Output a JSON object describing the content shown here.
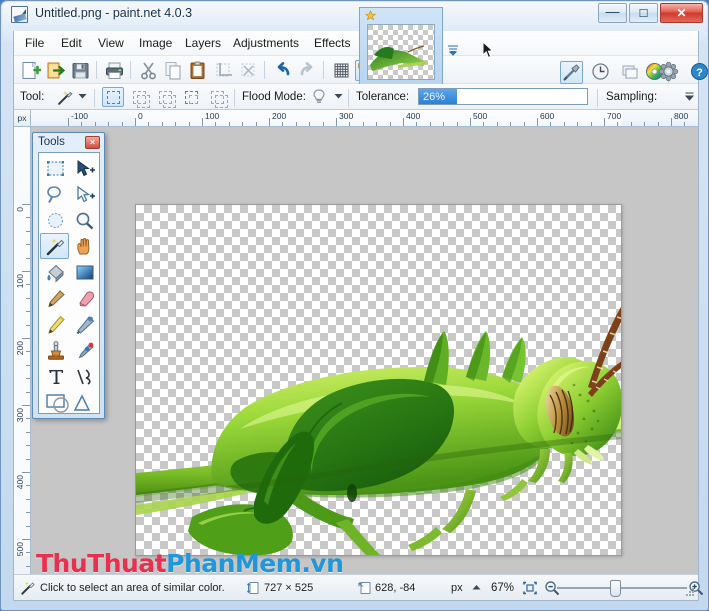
{
  "window": {
    "title": "Untitled.png - paint.net 4.0.3",
    "app_icon": "paintnet-app-icon",
    "controls": {
      "minimize": "—",
      "maximize": "❐",
      "close": "✕"
    }
  },
  "menubar": {
    "items": [
      {
        "label": "File"
      },
      {
        "label": "Edit"
      },
      {
        "label": "View"
      },
      {
        "label": "Image"
      },
      {
        "label": "Layers"
      },
      {
        "label": "Adjustments"
      },
      {
        "label": "Effects"
      }
    ]
  },
  "toolbar": {
    "buttons": [
      {
        "name": "new-icon",
        "tip": "New"
      },
      {
        "name": "open-icon",
        "tip": "Open"
      },
      {
        "name": "save-icon",
        "tip": "Save"
      },
      {
        "name": "print-icon",
        "tip": "Print"
      },
      {
        "name": "cut-icon",
        "tip": "Cut"
      },
      {
        "name": "copy-icon",
        "tip": "Copy"
      },
      {
        "name": "paste-icon",
        "tip": "Paste"
      },
      {
        "name": "crop-to-selection-icon",
        "tip": "Crop to Selection"
      },
      {
        "name": "deselect-all-icon",
        "tip": "Deselect All"
      },
      {
        "name": "undo-icon",
        "tip": "Undo"
      },
      {
        "name": "redo-icon",
        "tip": "Redo"
      },
      {
        "name": "grid-icon",
        "tip": "Show Pixel Grid"
      },
      {
        "name": "rulers-icon",
        "tip": "Show Rulers"
      }
    ]
  },
  "header_icons": [
    {
      "name": "tools-window-icon",
      "label": "Tools"
    },
    {
      "name": "history-window-icon",
      "label": "History"
    },
    {
      "name": "layers-window-icon",
      "label": "Layers"
    },
    {
      "name": "colors-window-icon",
      "label": "Colors"
    },
    {
      "name": "settings-icon",
      "label": "Settings"
    },
    {
      "name": "help-icon",
      "label": "Help"
    }
  ],
  "thumbnail": {
    "name": "image-thumbnail-untitled",
    "pinned_icon": "star-icon",
    "dropdown_icon": "chevron-down-icon"
  },
  "tool_options": {
    "tool_label": "Tool:",
    "tool_selected_icon": "magic-wand-icon",
    "tool_dropdown_icon": "chevron-down-icon",
    "selection_modes": [
      {
        "name": "selection-mode-replace",
        "label": "Replace",
        "active": true
      },
      {
        "name": "selection-mode-union",
        "label": "Union",
        "active": false
      },
      {
        "name": "selection-mode-exclude",
        "label": "Exclude",
        "active": false
      },
      {
        "name": "selection-mode-xor",
        "label": "Xor",
        "active": false
      },
      {
        "name": "selection-mode-intersect",
        "label": "Intersect",
        "active": false
      }
    ],
    "flood_mode_label": "Flood Mode:",
    "flood_mode_icon": "lightbulb-icon",
    "tolerance_label": "Tolerance:",
    "tolerance_value": "26%",
    "tolerance_percent": 26,
    "sampling_label": "Sampling:",
    "overflow_icon": "overflow-chevron-icon"
  },
  "tools_palette": {
    "title": "Tools",
    "close_label": "✕",
    "tools": [
      {
        "name": "rectangle-select-tool",
        "label": "Rectangle Select",
        "selected": false
      },
      {
        "name": "move-selected-tool",
        "label": "Move Selected",
        "selected": false
      },
      {
        "name": "lasso-select-tool",
        "label": "Lasso Select",
        "selected": false
      },
      {
        "name": "move-selection-tool",
        "label": "Move Selection",
        "selected": false
      },
      {
        "name": "ellipse-select-tool",
        "label": "Ellipse Select",
        "selected": false
      },
      {
        "name": "zoom-tool",
        "label": "Zoom",
        "selected": false
      },
      {
        "name": "magic-wand-tool",
        "label": "Magic Wand",
        "selected": true
      },
      {
        "name": "pan-tool",
        "label": "Pan",
        "selected": false
      },
      {
        "name": "paint-bucket-tool",
        "label": "Paint Bucket",
        "selected": false
      },
      {
        "name": "gradient-tool",
        "label": "Gradient",
        "selected": false
      },
      {
        "name": "paintbrush-tool",
        "label": "Paintbrush",
        "selected": false
      },
      {
        "name": "eraser-tool",
        "label": "Eraser",
        "selected": false
      },
      {
        "name": "pencil-tool",
        "label": "Pencil",
        "selected": false
      },
      {
        "name": "color-picker-tool",
        "label": "Color Picker",
        "selected": false
      },
      {
        "name": "clone-stamp-tool",
        "label": "Clone Stamp",
        "selected": false
      },
      {
        "name": "recolor-tool",
        "label": "Recolor",
        "selected": false
      },
      {
        "name": "text-tool",
        "label": "Text",
        "selected": false
      },
      {
        "name": "line-curve-tool",
        "label": "Line / Curve",
        "selected": false
      },
      {
        "name": "shapes-tool",
        "label": "Shapes",
        "selected": false
      }
    ]
  },
  "rulers": {
    "unit_label": "px",
    "horizontal_labels": [
      "-100",
      "0",
      "100",
      "200",
      "300",
      "400",
      "500",
      "600",
      "700",
      "800"
    ],
    "vertical_labels": [
      "0",
      "100",
      "200",
      "300",
      "400",
      "500"
    ]
  },
  "canvas": {
    "name": "image-canvas",
    "content": "grasshopper-on-stem-transparent-background",
    "transparency_checker": true
  },
  "statusbar": {
    "tool_hint_icon": "magic-wand-icon",
    "tool_hint": "Click to select an area of similar color.",
    "size_icon": "image-size-icon",
    "image_size": "727 × 525",
    "cursor_icon": "cursor-position-icon",
    "cursor_position": "628, -84",
    "unit_label": "px",
    "unit_dropdown_icon": "chevron-up-icon",
    "zoom_level": "67%",
    "zoom_fit_icon": "zoom-to-fit-icon",
    "zoom_out_icon": "zoom-out-icon",
    "zoom_in_icon": "zoom-in-icon",
    "resize_grip_icon": "resize-grip-icon"
  },
  "watermark": {
    "part1": "Thu",
    "part2": "Thuat",
    "part3": "PhanMem",
    "part4": ".vn"
  },
  "colors": {
    "accent_blue": "#2b7fd4",
    "title_text": "#183048",
    "close_red": "#cf3b2e",
    "canvas_backdrop": "#c6c6c6",
    "watermark_red": "#e8304f",
    "watermark_blue": "#2196d9"
  }
}
